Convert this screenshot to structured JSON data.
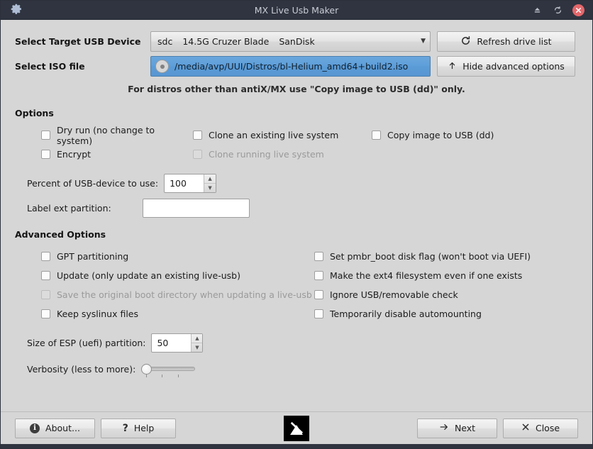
{
  "titlebar": {
    "app_icon": "gear-icon",
    "title": "MX Live Usb Maker",
    "minimize_icon": "minimize-icon",
    "maximize_icon": "maximize-restore-icon",
    "close_icon": "close-icon"
  },
  "top": {
    "target_label": "Select Target USB Device",
    "device": {
      "name": "sdc",
      "size": "14.5G Cruzer Blade",
      "vendor": "SanDisk"
    },
    "refresh_button": "Refresh drive list",
    "refresh_icon": "refresh-icon",
    "iso_label": "Select ISO file",
    "iso_path": "/media/avp/UUI/Distros/bl-Helium_amd64+build2.iso",
    "iso_icon": "disc-icon",
    "advanced_button": "Hide advanced options",
    "advanced_icon": "arrow-up-icon",
    "hint": "For distros other than antiX/MX use \"Copy image to USB (dd)\" only."
  },
  "options": {
    "title": "Options",
    "checkboxes": [
      {
        "label": "Dry run (no change to system)",
        "checked": false,
        "disabled": false
      },
      {
        "label": "Clone an existing live system",
        "checked": false,
        "disabled": false
      },
      {
        "label": "Copy image to USB (dd)",
        "checked": false,
        "disabled": false
      },
      {
        "label": "Encrypt",
        "checked": false,
        "disabled": false
      },
      {
        "label": "Clone running live system",
        "checked": false,
        "disabled": true
      }
    ],
    "percent_label": "Percent of USB-device to use:",
    "percent_value": "100",
    "label_ext_label": "Label ext partition:",
    "label_ext_value": ""
  },
  "advanced": {
    "title": "Advanced Options",
    "checkboxes": [
      {
        "label": "GPT partitioning",
        "checked": false,
        "disabled": false
      },
      {
        "label": "Set pmbr_boot disk flag (won't boot via UEFI)",
        "checked": false,
        "disabled": false
      },
      {
        "label": "Update (only update an existing live-usb)",
        "checked": false,
        "disabled": false
      },
      {
        "label": "Make the ext4 filesystem even if one exists",
        "checked": false,
        "disabled": false
      },
      {
        "label": "Save the original boot directory when updating a live-usb",
        "checked": false,
        "disabled": true
      },
      {
        "label": "Ignore USB/removable check",
        "checked": false,
        "disabled": false
      },
      {
        "label": "Keep syslinux files",
        "checked": false,
        "disabled": false
      },
      {
        "label": "Temporarily disable automounting",
        "checked": false,
        "disabled": false
      }
    ],
    "esp_label": "Size of ESP (uefi) partition:",
    "esp_value": "50",
    "verbosity_label": "Verbosity (less to more):",
    "verbosity_position": 0
  },
  "footer": {
    "about_button": "About...",
    "about_icon": "info-icon",
    "help_button": "Help",
    "help_icon": "question-mark-icon",
    "logo": "antix-mx-logo",
    "next_button": "Next",
    "next_icon": "arrow-right-icon",
    "close_button": "Close",
    "close_icon": "x-icon"
  },
  "colors": {
    "titlebar_bg": "#2f3440",
    "window_bg": "#d6d6d6",
    "accent_blue": "#5d9ed9",
    "close_red": "#e4666a"
  }
}
